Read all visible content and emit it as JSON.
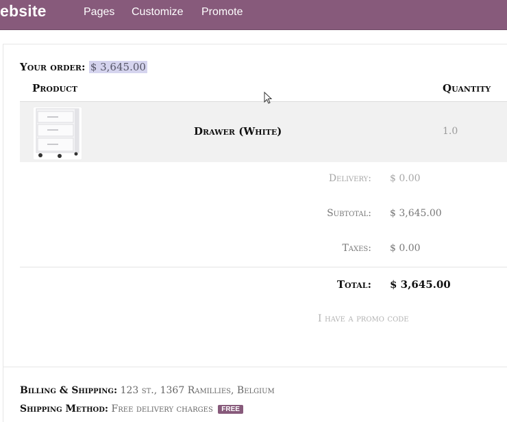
{
  "topbar": {
    "brand": "ebsite",
    "nav": [
      "Pages",
      "Customize",
      "Promote"
    ],
    "color": "#875a7b"
  },
  "order": {
    "label": "Your order:",
    "amount": "$ 3,645.00"
  },
  "table": {
    "headers": {
      "product": "Product",
      "quantity": "Quantity"
    },
    "rows": [
      {
        "name": "Drawer (White)",
        "quantity": "1.0",
        "image_icon": "drawer-unit-image"
      }
    ]
  },
  "totals": {
    "delivery_label": "Delivery:",
    "delivery_value": "$ 0.00",
    "subtotal_label": "Subtotal:",
    "subtotal_value": "$ 3,645.00",
    "taxes_label": "Taxes:",
    "taxes_value": "$ 0.00",
    "total_label": "Total:",
    "total_value": "$ 3,645.00"
  },
  "promo": {
    "label": "I have a promo code"
  },
  "footer": {
    "billing_label": "Billing & Shipping:",
    "billing_value": "123 st., 1367 Ramillies, Belgium",
    "shipping_label": "Shipping Method:",
    "shipping_value": "Free delivery charges",
    "shipping_badge": "Free"
  }
}
